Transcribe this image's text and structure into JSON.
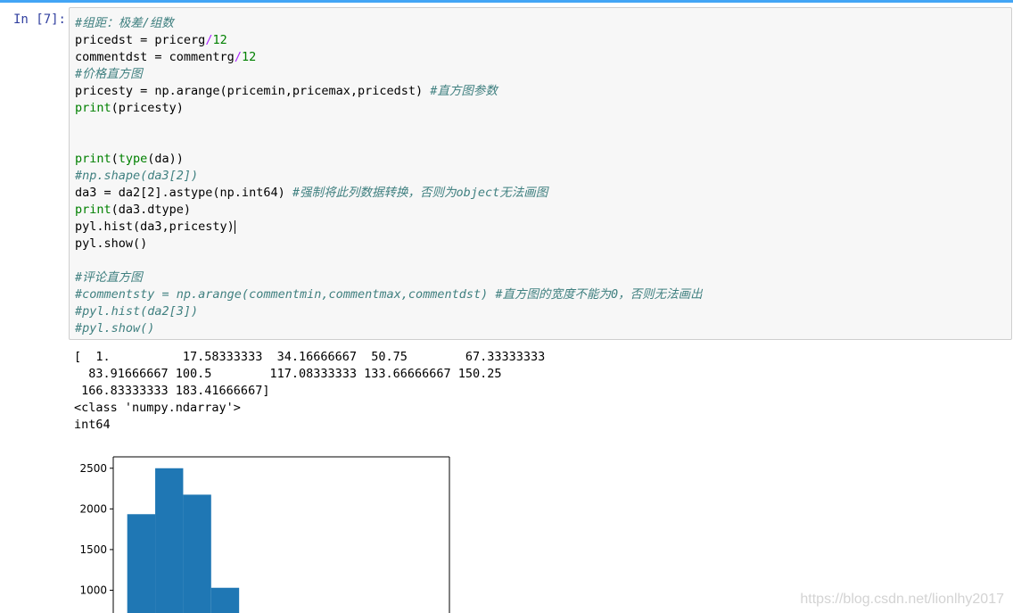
{
  "cell": {
    "prompt": "In [7]:",
    "code": {
      "l1": "#组距：极差/组数",
      "l2a": "pricedst = pricerg",
      "l2op": "/",
      "l2n": "12",
      "l3a": "commentdst = commentrg",
      "l3op": "/",
      "l3n": "12",
      "l4": "#价格直方图",
      "l5a": "pricesty = np.arange(pricemin,pricemax,pricedst) ",
      "l5c": "#直方图参数",
      "l6kw": "print",
      "l6b": "(pricesty)",
      "l9kw": "print",
      "l9b": "(",
      "l9kw2": "type",
      "l9c": "(da))",
      "l10": "#np.shape(da3[2])",
      "l11a": "da3 = da2[2].astype(np.int64) ",
      "l11c": "#强制将此列数据转换，否则为object无法画图",
      "l12kw": "print",
      "l12b": "(da3.dtype)",
      "l13": "pyl.hist(da3,pricesty)",
      "l14": "pyl.show()",
      "l16": "#评论直方图",
      "l17": "#commentsty = np.arange(commentmin,commentmax,commentdst) #直方图的宽度不能为0，否则无法画出",
      "l18": "#pyl.hist(da2[3])",
      "l19": "#pyl.show()"
    }
  },
  "output": {
    "o1": "[  1.          17.58333333  34.16666667  50.75        67.33333333",
    "o2": "  83.91666667 100.5        117.08333333 133.66666667 150.25",
    "o3": " 166.83333333 183.41666667]",
    "o4": "<class 'numpy.ndarray'>",
    "o5": "int64"
  },
  "chart_data": {
    "type": "bar",
    "title": "",
    "xlabel": "",
    "ylabel": "",
    "y_ticks": [
      "2500",
      "2000",
      "1500",
      "1000"
    ],
    "ylim": [
      720,
      2640
    ],
    "bin_edges": [
      1,
      17.58333333,
      34.16666667,
      50.75,
      67.33333333
    ],
    "values": [
      1935,
      2500,
      2175,
      1030
    ],
    "color": "#1f77b4"
  },
  "watermark": "https://blog.csdn.net/lionlhy2017"
}
